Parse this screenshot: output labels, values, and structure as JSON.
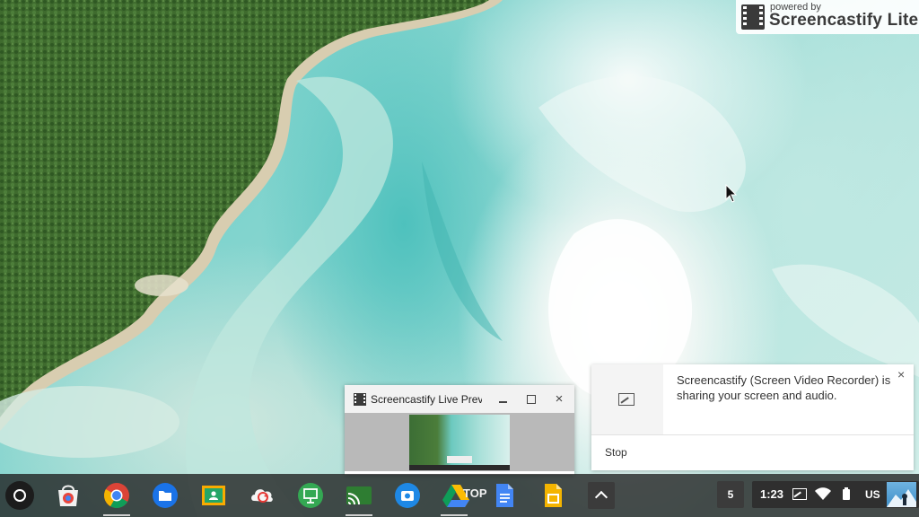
{
  "watermark": {
    "powered_by": "powered by",
    "brand": "Screencastify Lite"
  },
  "notification": {
    "title": "Screencastify (Screen Video Recorder) is sharing your screen and audio.",
    "close": "×",
    "action": "Stop",
    "icon": "screen-share-icon"
  },
  "preview_window": {
    "title": "Screencastify Live Preview",
    "minimize": "minimize-icon",
    "maximize": "maximize-icon",
    "close": "×"
  },
  "shelf": {
    "apps": [
      {
        "name": "chrome-web-store-icon",
        "color": "#e8453c"
      },
      {
        "name": "chrome-icon",
        "color": "#4285f4"
      },
      {
        "name": "files-icon",
        "color": "#1a73e8"
      },
      {
        "name": "google-classroom-icon",
        "color": "#f9ab00"
      },
      {
        "name": "sync-app-icon",
        "color": "#e53935"
      },
      {
        "name": "presentation-app-icon",
        "color": "#34a853"
      },
      {
        "name": "cast-app-icon",
        "color": "#2e7d32"
      },
      {
        "name": "camera-icon",
        "color": "#1e88e5"
      },
      {
        "name": "google-drive-icon",
        "color": "#fbbc04"
      },
      {
        "name": "google-docs-icon",
        "color": "#4285f4"
      },
      {
        "name": "google-slides-icon",
        "color": "#f4b400"
      }
    ],
    "drive_overlay_text": "TOP",
    "notification_count": "5",
    "time": "1:23",
    "language": "US"
  }
}
